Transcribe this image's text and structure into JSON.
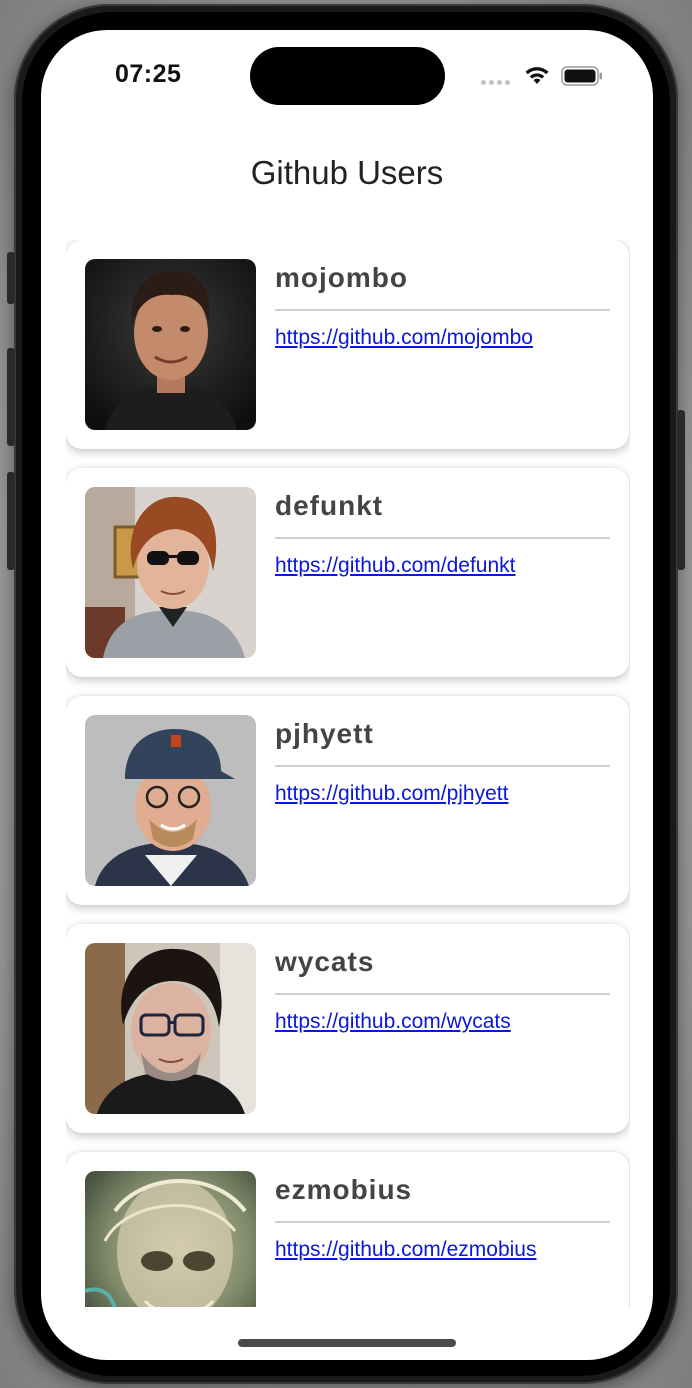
{
  "status": {
    "time": "07:25"
  },
  "header": {
    "title": "Github Users"
  },
  "users": [
    {
      "login": "mojombo",
      "url": "https://github.com/mojombo"
    },
    {
      "login": "defunkt",
      "url": "https://github.com/defunkt"
    },
    {
      "login": "pjhyett",
      "url": "https://github.com/pjhyett"
    },
    {
      "login": "wycats",
      "url": "https://github.com/wycats"
    },
    {
      "login": "ezmobius",
      "url": "https://github.com/ezmobius"
    }
  ],
  "colors": {
    "link": "#0a18d8",
    "username": "#444444",
    "background": "#ffffff"
  }
}
